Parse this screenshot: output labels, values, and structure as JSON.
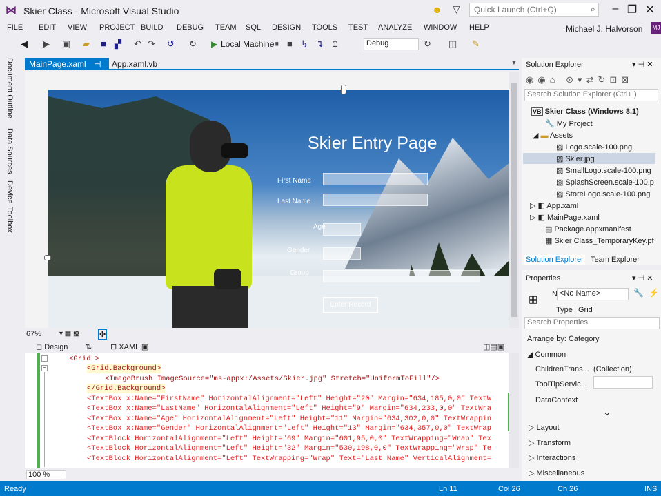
{
  "window": {
    "title": "Skier Class - Microsoft Visual Studio",
    "quick_launch_placeholder": "Quick Launch (Ctrl+Q)"
  },
  "menu": [
    "FILE",
    "EDIT",
    "VIEW",
    "PROJECT",
    "BUILD",
    "DEBUG",
    "TEAM",
    "SQL",
    "DESIGN",
    "TOOLS",
    "TEST",
    "ANALYZE",
    "WINDOW",
    "HELP"
  ],
  "user": {
    "name": "Michael J. Halvorson",
    "initials": "MJ"
  },
  "toolbar": {
    "run_label": "Local Machine",
    "config": "Debug"
  },
  "left_tabs": [
    "Document Outline",
    "Data Sources",
    "Device",
    "Toolbox"
  ],
  "tabs": [
    {
      "label": "MainPage.xaml"
    },
    {
      "label": "App.xaml.vb"
    }
  ],
  "designer": {
    "heading": "Skier Entry Page",
    "fields": [
      "First Name",
      "Last Name",
      "Age",
      "Gender",
      "Group"
    ],
    "button": "Enter Record",
    "zoom": "67%"
  },
  "view_tabs": {
    "design": "Design",
    "xaml": "XAML"
  },
  "xaml_lines": [
    "<Grid >",
    "<Grid.Background>",
    "<ImageBrush ImageSource=\"ms-appx:/Assets/Skier.jpg\" Stretch=\"UniformToFill\"/>",
    "</Grid.Background>",
    "<TextBox x:Name=\"FirstName\" HorizontalAlignment=\"Left\" Height=\"20\" Margin=\"634,185,0,0\" TextW",
    "<TextBox x:Name=\"LastName\" HorizontalAlignment=\"Left\" Height=\"9\" Margin=\"634,233,0,0\" TextWra",
    "<TextBox x:Name=\"Age\" HorizontalAlignment=\"Left\" Height=\"11\" Margin=\"634,302,0,0\" TextWrappin",
    "<TextBox x:Name=\"Gender\" HorizontalAlignment=\"Left\" Height=\"13\" Margin=\"634,357,0,0\" TextWrap",
    "<TextBlock HorizontalAlignment=\"Left\" Height=\"69\" Margin=\"601,95,0,0\" TextWrapping=\"Wrap\" Tex",
    "<TextBlock HorizontalAlignment=\"Left\" Height=\"32\" Margin=\"530,198,0,0\" TextWrapping=\"Wrap\" Te",
    "<TextBlock HorizontalAlignment=\"Left\" TextWrapping=\"Wrap\" Text=\"Last Name\" VerticalAlignment="
  ],
  "editor_zoom": "100 %",
  "status": {
    "ready": "Ready",
    "ln": "Ln 11",
    "col": "Col 26",
    "ch": "Ch 26",
    "mode": "INS"
  },
  "solution_explorer": {
    "title": "Solution Explorer",
    "search_placeholder": "Search Solution Explorer (Ctrl+;)",
    "items": [
      {
        "label": "Skier Class (Windows 8.1)"
      },
      {
        "label": "My Project"
      },
      {
        "label": "Assets"
      },
      {
        "label": "Logo.scale-100.png"
      },
      {
        "label": "Skier.jpg"
      },
      {
        "label": "SmallLogo.scale-100.png"
      },
      {
        "label": "SplashScreen.scale-100.p"
      },
      {
        "label": "StoreLogo.scale-100.png"
      },
      {
        "label": "App.xaml"
      },
      {
        "label": "MainPage.xaml"
      },
      {
        "label": "Package.appxmanifest"
      },
      {
        "label": "Skier Class_TemporaryKey.pf"
      }
    ],
    "tabs": [
      "Solution Explorer",
      "Team Explorer"
    ]
  },
  "properties": {
    "title": "Properties",
    "name_label": "Name",
    "name_value": "<No Name>",
    "type_label": "Type",
    "type_value": "Grid",
    "search_placeholder": "Search Properties",
    "arrange": "Arrange by: Category",
    "common": "Common",
    "rows": [
      {
        "label": "ChildrenTrans...",
        "value": "(Collection)"
      },
      {
        "label": "ToolTipServic...",
        "value": ""
      },
      {
        "label": "DataContext",
        "value": ""
      }
    ],
    "categories": [
      "Layout",
      "Transform",
      "Interactions",
      "Miscellaneous"
    ]
  }
}
